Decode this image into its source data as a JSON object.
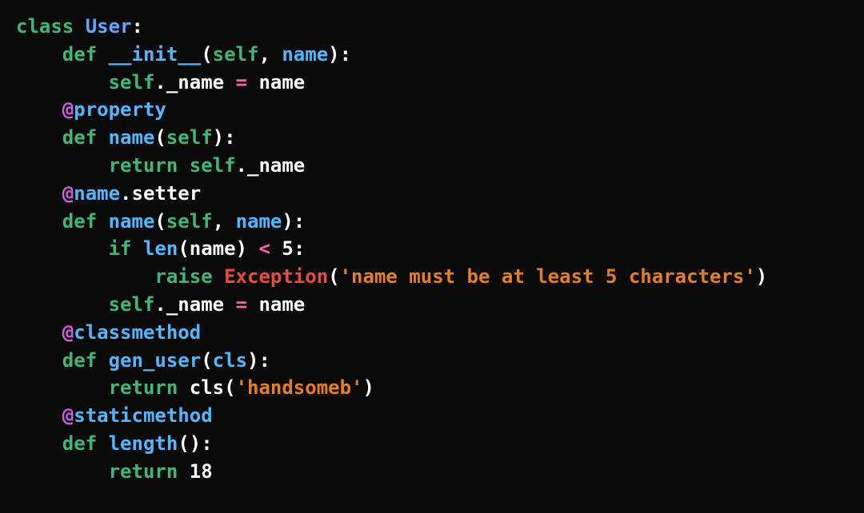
{
  "code": {
    "line1": {
      "class_kw": "class",
      "classname": "User",
      "colon": ":"
    },
    "line2": {
      "def_kw": "def",
      "funcname": "__init__",
      "paren_open": "(",
      "self": "self",
      "comma": ", ",
      "param": "name",
      "paren_close": "):"
    },
    "line3": {
      "self": "self",
      "attr": "._name ",
      "op": "=",
      "sp": " ",
      "val": "name"
    },
    "line4": {
      "at": "@",
      "dec": "property"
    },
    "line5": {
      "def_kw": "def",
      "funcname": "name",
      "paren_open": "(",
      "self": "self",
      "paren_close": "):"
    },
    "line6": {
      "ret": "return",
      "sp": " ",
      "self": "self",
      "attr": "._name"
    },
    "line7": {
      "at": "@",
      "obj": "name",
      "dot": ".",
      "method": "setter"
    },
    "line8": {
      "def_kw": "def",
      "funcname": "name",
      "paren_open": "(",
      "self": "self",
      "comma": ", ",
      "param": "name",
      "paren_close": "):"
    },
    "line9": {
      "if_kw": "if",
      "sp": " ",
      "builtin": "len",
      "paren_open": "(",
      "arg": "name",
      "paren_close": ") ",
      "op": "<",
      "sp2": " ",
      "num": "5",
      "colon": ":"
    },
    "line10": {
      "raise_kw": "raise",
      "sp": " ",
      "exc": "Exception",
      "paren_open": "(",
      "str": "'name must be at least 5 characters'",
      "paren_close": ")"
    },
    "line11": {
      "self": "self",
      "attr": "._name ",
      "op": "=",
      "sp": " ",
      "val": "name"
    },
    "line12": {
      "at": "@",
      "dec": "classmethod"
    },
    "line13": {
      "def_kw": "def",
      "funcname": "gen_user",
      "paren_open": "(",
      "param": "cls",
      "paren_close": "):"
    },
    "line14": {
      "ret": "return",
      "sp": " ",
      "cls": "cls",
      "paren_open": "(",
      "str": "'handsomeb'",
      "paren_close": ")"
    },
    "line15": {
      "at": "@",
      "dec": "staticmethod"
    },
    "line16": {
      "def_kw": "def",
      "funcname": "length",
      "parens": "():"
    },
    "line17": {
      "ret": "return",
      "sp": " ",
      "num": "18"
    }
  }
}
